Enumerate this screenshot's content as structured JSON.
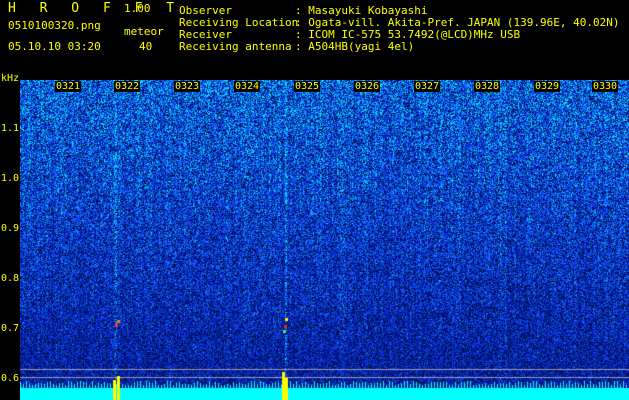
{
  "header": {
    "title": "H R O F F T",
    "version": "1.00",
    "filename": "0510100320.png",
    "meteor_label": "meteor",
    "timestamp": "05.10.10 03:20",
    "meteor_count": "40"
  },
  "info": [
    {
      "label": "Observer",
      "value": ": Masayuki Kobayashi"
    },
    {
      "label": "Receiving Location",
      "value": ": Ogata-vill. Akita-Pref. JAPAN (139.96E, 40.02N)"
    },
    {
      "label": "Receiver",
      "value": ": ICOM IC-575 53.7492(@LCD)MHz USB"
    },
    {
      "label": "Receiving antenna",
      "value": ": A504HB(yagi 4el)"
    }
  ],
  "yaxis": {
    "unit": "kHz",
    "ticks": [
      "1.1",
      "1.0",
      "0.9",
      "0.8",
      "0.7",
      "0.6"
    ]
  },
  "xaxis": {
    "ticks": [
      "0321",
      "0322",
      "0323",
      "0324",
      "0325",
      "0326",
      "0327",
      "0328",
      "0329",
      "0330"
    ]
  },
  "colors": {
    "text": "#ffff00",
    "background": "#000000",
    "spectrum_low": "#000a50",
    "spectrum_mid": "#1e46ff",
    "spectrum_high": "#00ffff"
  }
}
